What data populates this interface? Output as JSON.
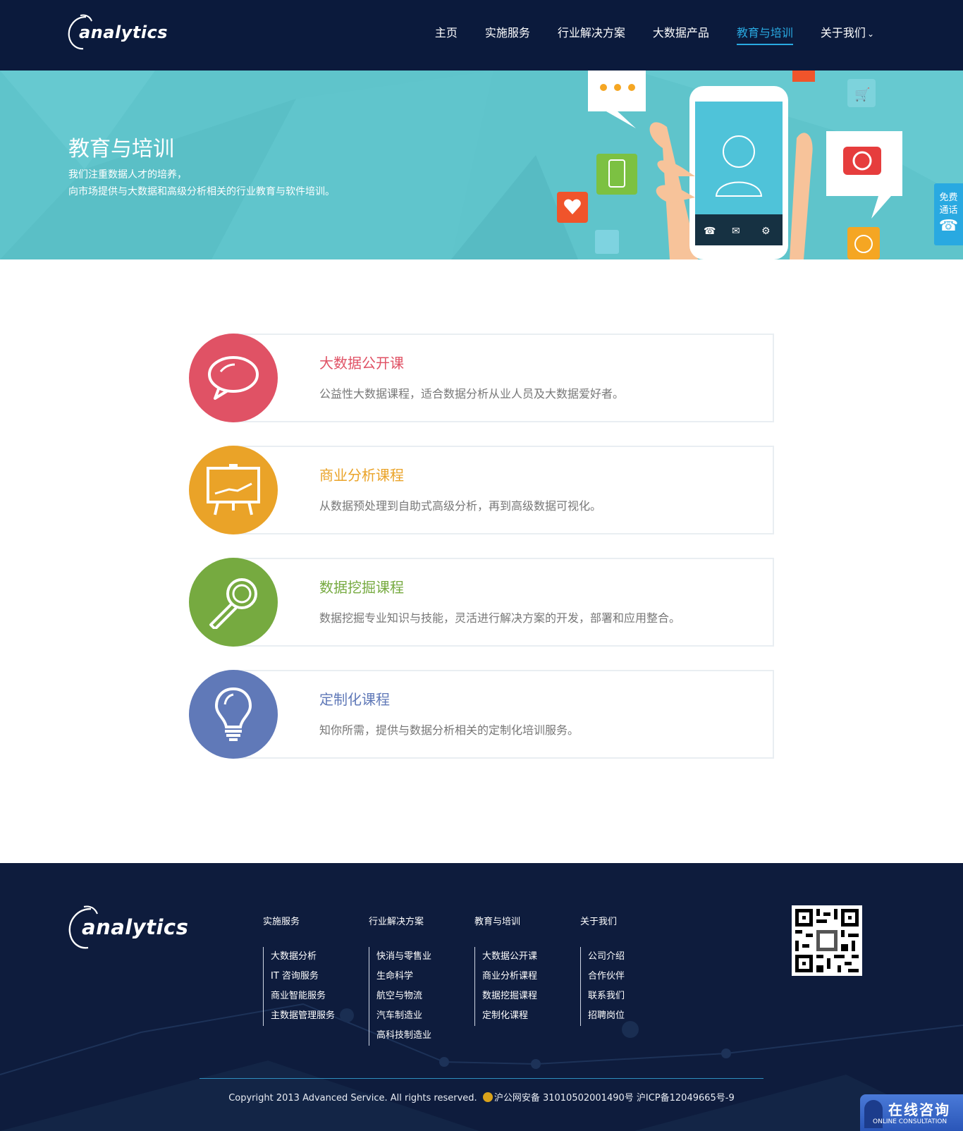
{
  "header": {
    "logo_text": "analytics",
    "nav": [
      {
        "label": "主页"
      },
      {
        "label": "实施服务"
      },
      {
        "label": "行业解决方案"
      },
      {
        "label": "大数据产品"
      },
      {
        "label": "教育与培训"
      },
      {
        "label": "关于我们"
      }
    ],
    "active_nav": "教育与培训",
    "colors": {
      "bg": "#0b1a3c",
      "active": "#29a9e1"
    }
  },
  "banner": {
    "title": "教育与培训",
    "sub_line1": "我们注重数据人才的培养，",
    "sub_line2": "向市场提供与大数据和高级分析相关的行业教育与软件培训。"
  },
  "side_call": {
    "line1": "免费",
    "line2": "通话",
    "icon": "phone-icon"
  },
  "courses": [
    {
      "title": "大数据公开课",
      "desc": "公益性大数据课程，适合数据分析从业人员及大数据爱好者。",
      "color": "#e05265",
      "icon": "speech-bubble-icon"
    },
    {
      "title": "商业分析课程",
      "desc": "从数据预处理到自助式高级分析，再到高级数据可视化。",
      "color": "#eaa328",
      "icon": "presentation-board-icon"
    },
    {
      "title": "数据挖掘课程",
      "desc": "数据挖掘专业知识与技能，灵活进行解决方案的开发，部署和应用整合。",
      "color": "#76aa40",
      "icon": "magnifier-icon"
    },
    {
      "title": "定制化课程",
      "desc": "知你所需，提供与数据分析相关的定制化培训服务。",
      "color": "#6079b8",
      "icon": "lightbulb-icon"
    }
  ],
  "footer": {
    "logo_text": "analytics",
    "columns": [
      {
        "title": "实施服务",
        "links": [
          "大数据分析",
          "IT 咨询服务",
          "商业智能服务",
          "主数据管理服务"
        ]
      },
      {
        "title": "行业解决方案",
        "links": [
          "快消与零售业",
          "生命科学",
          "航空与物流",
          "汽车制造业",
          "高科技制造业"
        ]
      },
      {
        "title": "教育与培训",
        "links": [
          "大数据公开课",
          "商业分析课程",
          "数据挖掘课程",
          "定制化课程"
        ]
      },
      {
        "title": "关于我们",
        "links": [
          "公司介绍",
          "合作伙伴",
          "联系我们",
          "招聘岗位"
        ]
      }
    ],
    "copyright": "Copyright 2013 Advanced Service. All rights reserved.",
    "police_record": "沪公网安备 31010502001490号 沪ICP备12049665号-9",
    "online_cn": "在线咨询",
    "online_en": "ONLINE CONSULTATION"
  }
}
